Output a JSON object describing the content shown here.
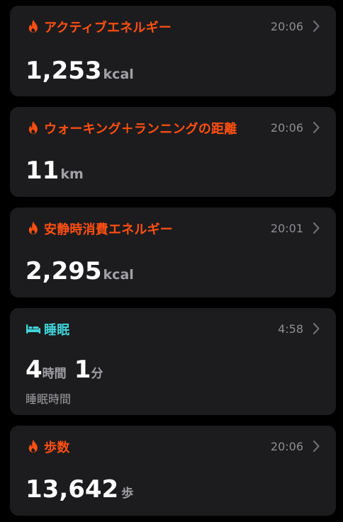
{
  "colors": {
    "accent_activity": "#ff4f12",
    "accent_sleep": "#40d4d9",
    "card_bg": "#1c1c1e",
    "muted_text": "#8e8e93"
  },
  "cards": [
    {
      "icon": "flame-icon",
      "title": "アクティブエネルギー",
      "time": "20:06",
      "value": "1,253",
      "unit": "kcal"
    },
    {
      "icon": "flame-icon",
      "title": "ウォーキング＋ランニングの距離",
      "time": "20:06",
      "value": "11",
      "unit": "km"
    },
    {
      "icon": "flame-icon",
      "title": "安静時消費エネルギー",
      "time": "20:01",
      "value": "2,295",
      "unit": "kcal"
    },
    {
      "icon": "bed-icon",
      "title": "睡眠",
      "time": "4:58",
      "hours": "4",
      "hours_unit": "時間",
      "minutes": "1",
      "minutes_unit": "分",
      "subtitle": "睡眠時間"
    },
    {
      "icon": "flame-icon",
      "title": "歩数",
      "time": "20:06",
      "value": "13,642",
      "unit": "歩"
    }
  ]
}
